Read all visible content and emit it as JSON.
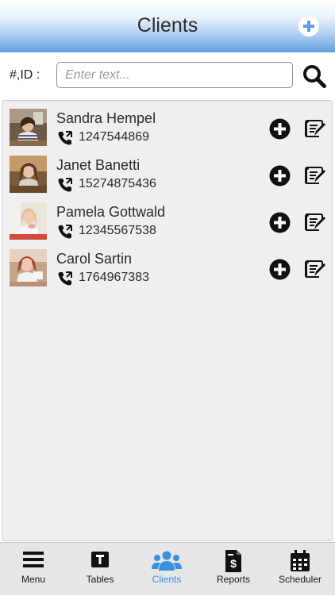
{
  "header": {
    "title": "Clients"
  },
  "search": {
    "label": "#,ID :",
    "placeholder": "Enter text..."
  },
  "clients": [
    {
      "name": "Sandra Hempel",
      "phone": "1247544869"
    },
    {
      "name": "Janet Banetti",
      "phone": "15274875436"
    },
    {
      "name": "Pamela Gottwald",
      "phone": "12345567538"
    },
    {
      "name": "Carol Sartin",
      "phone": "1764967383"
    }
  ],
  "nav": {
    "items": [
      {
        "label": "Menu",
        "icon": "hamburger-icon"
      },
      {
        "label": "Tables",
        "icon": "tables-icon"
      },
      {
        "label": "Clients",
        "icon": "people-icon"
      },
      {
        "label": "Reports",
        "icon": "report-dollar-icon"
      },
      {
        "label": "Scheduler",
        "icon": "calendar-icon"
      }
    ],
    "active": "Clients"
  },
  "colors": {
    "header_gradient_bottom": "#5e9fe0",
    "active_nav": "#3a8fdf",
    "list_background": "#efefef",
    "nav_background": "#e6e6e6"
  }
}
